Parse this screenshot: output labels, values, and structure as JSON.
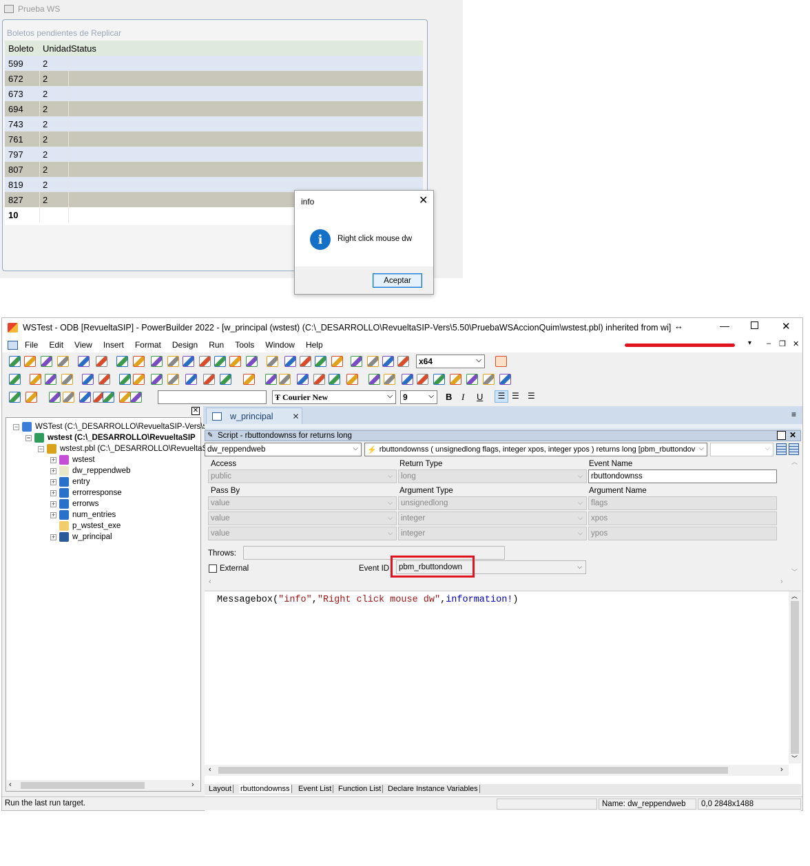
{
  "top_window": {
    "title": "Prueba WS",
    "datawindow_title": "Boletos pendientes de Replicar",
    "columns": [
      "Boleto",
      "Unidad",
      "Status"
    ],
    "rows": [
      {
        "boleto": "599",
        "unidad": "2",
        "status": ""
      },
      {
        "boleto": "672",
        "unidad": "2",
        "status": ""
      },
      {
        "boleto": "673",
        "unidad": "2",
        "status": ""
      },
      {
        "boleto": "694",
        "unidad": "2",
        "status": ""
      },
      {
        "boleto": "743",
        "unidad": "2",
        "status": ""
      },
      {
        "boleto": "761",
        "unidad": "2",
        "status": ""
      },
      {
        "boleto": "797",
        "unidad": "2",
        "status": ""
      },
      {
        "boleto": "807",
        "unidad": "2",
        "status": ""
      },
      {
        "boleto": "819",
        "unidad": "2",
        "status": ""
      },
      {
        "boleto": "827",
        "unidad": "2",
        "status": ""
      }
    ],
    "total": "10"
  },
  "dialog": {
    "title": "info",
    "message": "Right click mouse dw",
    "ok_label": "Aceptar",
    "icon": "information-icon"
  },
  "ide": {
    "title": "WSTest - ODB [RevueltaSIP]  - PowerBuilder 2022 - [w_principal (wstest) (C:\\_DESARROLLO\\RevueltaSIP-Vers\\5.50\\PruebaWSAccionQuim\\wstest.pbl) inherited from wi]",
    "menu": [
      "File",
      "Edit",
      "View",
      "Insert",
      "Format",
      "Design",
      "Run",
      "Tools",
      "Window",
      "Help"
    ],
    "platform": "x64",
    "font_name": "Courier New",
    "font_size": "9",
    "tree": [
      {
        "label": "WSTest (C:\\_DESARROLLO\\RevueltaSIP-Vers\\5.",
        "level": 0,
        "bold": false
      },
      {
        "label": "wstest (C:\\_DESARROLLO\\RevueltaSIP",
        "level": 1,
        "bold": true
      },
      {
        "label": "wstest.pbl (C:\\_DESARROLLO\\RevueltaS",
        "level": 2,
        "bold": false
      },
      {
        "label": "wstest",
        "level": 3,
        "bold": false
      },
      {
        "label": "dw_reppendweb",
        "level": 3,
        "bold": false
      },
      {
        "label": "entry",
        "level": 3,
        "bold": false
      },
      {
        "label": "errorresponse",
        "level": 3,
        "bold": false
      },
      {
        "label": "errorws",
        "level": 3,
        "bold": false
      },
      {
        "label": "num_entries",
        "level": 3,
        "bold": false
      },
      {
        "label": "p_wstest_exe",
        "level": 3,
        "bold": false
      },
      {
        "label": "w_principal",
        "level": 3,
        "bold": false
      }
    ],
    "tab_label": "w_principal",
    "script_header": "Script - rbuttondownss for  returns long",
    "object_combo": "dw_reppendweb",
    "event_combo": "rbuttondownss ( unsignedlong flags, integer xpos, integer ypos )  returns long [pbm_rbuttondov",
    "labels": {
      "access": "Access",
      "return_type": "Return Type",
      "event_name": "Event Name",
      "pass_by": "Pass By",
      "argument_type": "Argument Type",
      "argument_name": "Argument Name",
      "throws": "Throws:",
      "external": "External",
      "event_id": "Event ID"
    },
    "access_value": "public",
    "return_value": "long",
    "event_name_value": "rbuttondownss",
    "arguments": [
      {
        "pass_by": "value",
        "type": "unsignedlong",
        "name": "flags"
      },
      {
        "pass_by": "value",
        "type": "integer",
        "name": "xpos"
      },
      {
        "pass_by": "value",
        "type": "integer",
        "name": "ypos"
      }
    ],
    "event_id_value": "pbm_rbuttondown",
    "code": {
      "fn": "Messagebox(",
      "s1": "\"info\"",
      "comma1": ",",
      "s2": "\"Right click mouse dw\"",
      "comma2": ",",
      "kw": "information!",
      "close": ")"
    },
    "bottom_tabs": [
      "Layout",
      "rbuttondownss",
      "Event List",
      "Function List",
      "Declare Instance Variables"
    ],
    "status": {
      "message": "Run the last run target.",
      "name": "Name: dw_reppendweb",
      "coords": "0,0 2848x1488"
    },
    "colors": {
      "highlight": "#e0141e",
      "string": "#a31515",
      "keyword": "#0000c0"
    }
  }
}
